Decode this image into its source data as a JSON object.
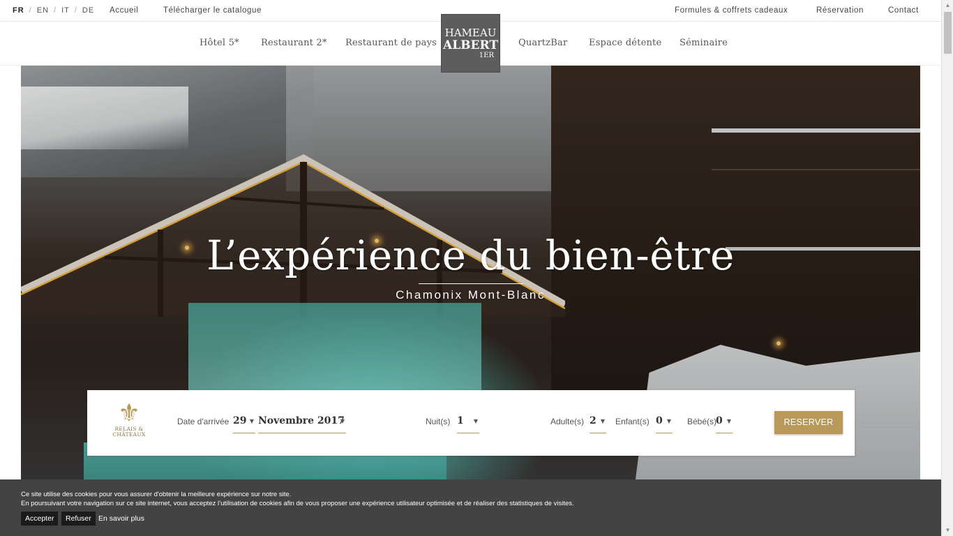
{
  "languages": [
    {
      "code": "FR",
      "active": true
    },
    {
      "code": "EN",
      "active": false
    },
    {
      "code": "IT",
      "active": false
    },
    {
      "code": "DE",
      "active": false
    }
  ],
  "language_separator": "/",
  "top_links": {
    "home": "Accueil",
    "catalogue": "Télécharger le catalogue",
    "gifts": "Formules & coffrets cadeaux",
    "booking": "Réservation",
    "contact": "Contact"
  },
  "nav": {
    "hotel": "Hôtel 5*",
    "restaurant2": "Restaurant 2*",
    "restaurant_pays": "Restaurant de pays",
    "quartzbar": "QuartzBar",
    "espace": "Espace détente",
    "seminaire": "Séminaire"
  },
  "logo": {
    "line1": "HAMEAU",
    "line2": "ALBERT",
    "line3": "1ER"
  },
  "hero": {
    "title": "L’expérience du bien-être",
    "subtitle": "Chamonix Mont-Blanc"
  },
  "booking": {
    "partner_logo": {
      "line1": "RELAIS &",
      "line2": "CHÂTEAUX",
      "icon": "fleur-de-lis-icon"
    },
    "arrival_label": "Date d'arrivée",
    "arrival_day": "29",
    "arrival_month": "Novembre 2017",
    "nights_label": "Nuit(s)",
    "nights_value": "1",
    "adults_label": "Adulte(s)",
    "adults_value": "2",
    "children_label": "Enfant(s)",
    "children_value": "0",
    "babies_label": "Bébé(s)",
    "babies_value": "0",
    "reserve_label": "RESERVER",
    "accent_color": "#b8995a"
  },
  "cookie": {
    "line1": "Ce site utilise des cookies pour vous assurer d'obtenir la meilleure expérience sur notre site.",
    "line2": "En poursuivant votre navigation sur ce site internet, vous acceptez l’utilisation de cookies afin de vous proposer une expérience utilisateur optimisée et de réaliser des statistiques de visites.",
    "accept": "Accepter",
    "refuse": "Refuser",
    "more": "En savoir plus"
  },
  "icons": {
    "caret": "▼",
    "scroll_up": "▲",
    "scroll_down": "▼"
  }
}
